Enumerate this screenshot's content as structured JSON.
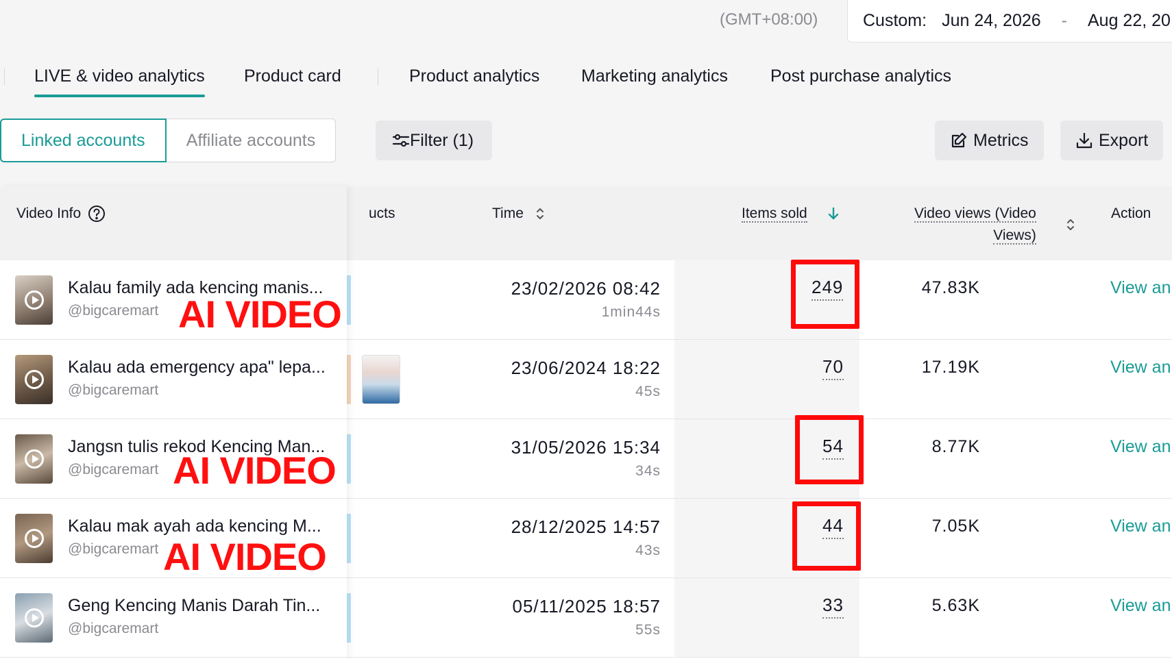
{
  "header": {
    "timezone": "(GMT+08:00)",
    "date_range": {
      "label": "Custom:",
      "start": "Jun 24, 2026",
      "separator": "-",
      "end": "Aug 22, 20"
    }
  },
  "nav_tabs": [
    {
      "label": "LIVE & video analytics",
      "active": true
    },
    {
      "label": "Product card",
      "active": false
    },
    {
      "label": "Product analytics",
      "active": false
    },
    {
      "label": "Marketing analytics",
      "active": false
    },
    {
      "label": "Post purchase analytics",
      "active": false
    }
  ],
  "toolbar": {
    "linked_accounts": "Linked accounts",
    "affiliate_accounts": "Affiliate accounts",
    "filter": "Filter (1)",
    "metrics": "Metrics",
    "export": "Export"
  },
  "table": {
    "columns": {
      "video_info": "Video Info",
      "products": "ucts",
      "time": "Time",
      "items_sold": "Items sold",
      "video_views_line1": "Video views (Video",
      "video_views_line2": "Views)",
      "action": "Action"
    },
    "rows": [
      {
        "title": "Kalau family ada kencing manis...",
        "user": "@bigcaremart",
        "time": "23/02/2026 08:42",
        "duration": "1min44s",
        "items_sold": "249",
        "views": "47.83K",
        "action": "View an"
      },
      {
        "title": "Kalau ada emergency apa\" lepa...",
        "user": "@bigcaremart",
        "time": "23/06/2024 18:22",
        "duration": "45s",
        "items_sold": "70",
        "views": "17.19K",
        "action": "View an"
      },
      {
        "title": "Jangsn tulis rekod Kencing Man...",
        "user": "@bigcaremart",
        "time": "31/05/2026 15:34",
        "duration": "34s",
        "items_sold": "54",
        "views": "8.77K",
        "action": "View an"
      },
      {
        "title": "Kalau mak ayah ada kencing M...",
        "user": "@bigcaremart",
        "time": "28/12/2025 14:57",
        "duration": "43s",
        "items_sold": "44",
        "views": "7.05K",
        "action": "View an"
      },
      {
        "title": "Geng Kencing Manis Darah Tin...",
        "user": "@bigcaremart",
        "time": "05/11/2025 18:57",
        "duration": "55s",
        "items_sold": "33",
        "views": "5.63K",
        "action": "View an"
      }
    ]
  },
  "overlays": {
    "ai_label": "AI VIDEO"
  },
  "colors": {
    "accent": "#1a9b96",
    "highlight": "#ff0a0a"
  }
}
